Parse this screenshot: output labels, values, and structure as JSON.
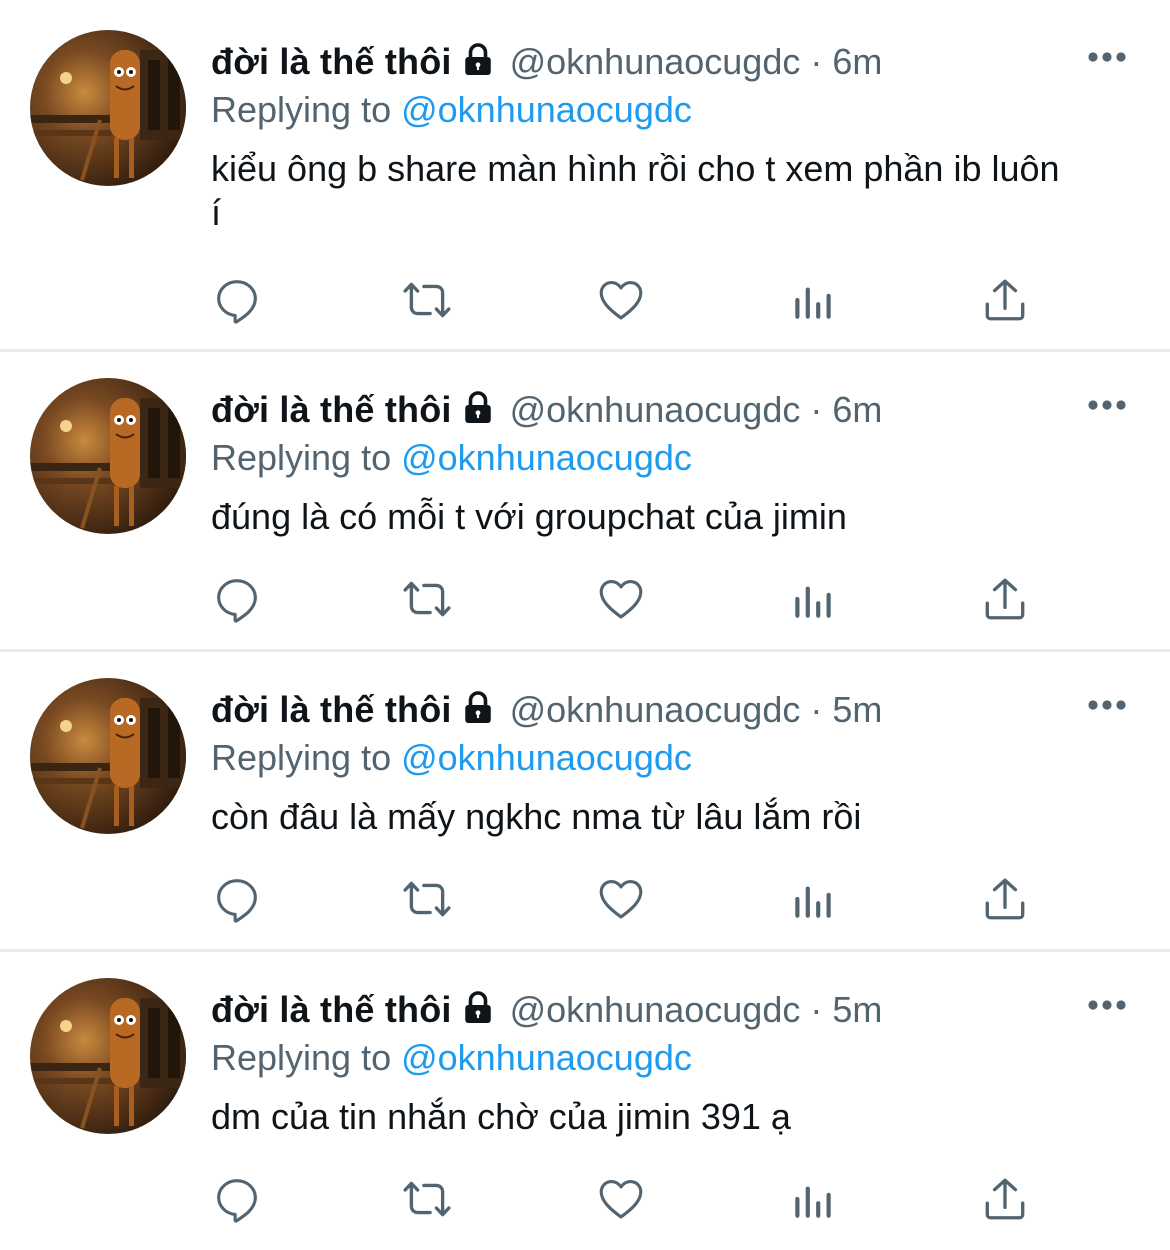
{
  "tweets": [
    {
      "display_name": "đời là thế thôi",
      "handle": "@oknhunaocugdc",
      "separator": "·",
      "time": "6m",
      "replying_prefix": "Replying to ",
      "replying_to": "@oknhunaocugdc",
      "text": "kiểu ông b share màn hình rồi cho t xem phần ib luôn í"
    },
    {
      "display_name": "đời là thế thôi",
      "handle": "@oknhunaocugdc",
      "separator": "·",
      "time": "6m",
      "replying_prefix": "Replying to ",
      "replying_to": "@oknhunaocugdc",
      "text": "đúng là có mỗi t với groupchat của jimin"
    },
    {
      "display_name": "đời là thế thôi",
      "handle": "@oknhunaocugdc",
      "separator": "·",
      "time": "5m",
      "replying_prefix": "Replying to ",
      "replying_to": "@oknhunaocugdc",
      "text": "còn đâu là mấy ngkhc nma từ lâu lắm rồi"
    },
    {
      "display_name": "đời là thế thôi",
      "handle": "@oknhunaocugdc",
      "separator": "·",
      "time": "5m",
      "replying_prefix": "Replying to ",
      "replying_to": "@oknhunaocugdc",
      "text": "dm của tin nhắn chờ của jimin 391 ạ"
    }
  ],
  "icons": {
    "lock": "lock-icon",
    "more": "more-icon",
    "reply": "reply-icon",
    "retweet": "retweet-icon",
    "like": "heart-icon",
    "views": "views-icon",
    "share": "share-icon"
  },
  "colors": {
    "text": "#0f1419",
    "secondary": "#536471",
    "mention": "#1d9bf0",
    "divider": "#e8ecef"
  }
}
